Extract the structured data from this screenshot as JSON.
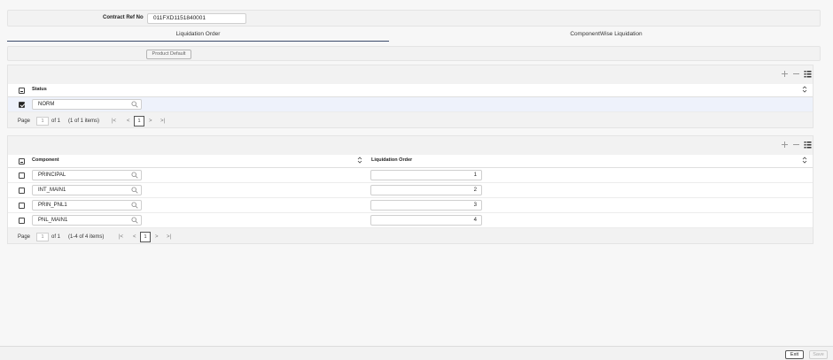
{
  "header": {
    "contract_ref_label": "Contract Ref No",
    "contract_ref_value": "011FXD1151840001"
  },
  "tabs": [
    {
      "label": "Liquidation Order",
      "active": true
    },
    {
      "label": "ComponentWise Liquidation",
      "active": false
    }
  ],
  "product_default_label": "Product Default",
  "status_grid": {
    "column": "Status",
    "rows": [
      {
        "value": "NORM",
        "checked": true
      }
    ],
    "pager": {
      "page_label": "Page",
      "page_value": "1",
      "of_label": "of 1",
      "items_label": "(1 of 1 items)",
      "current": "1"
    }
  },
  "component_grid": {
    "columns": [
      "Component",
      "Liquidation Order"
    ],
    "rows": [
      {
        "component": "PRINCIPAL",
        "order": "1"
      },
      {
        "component": "INT_MAIN1",
        "order": "2"
      },
      {
        "component": "PRIN_PNL1",
        "order": "3"
      },
      {
        "component": "PNL_MAIN1",
        "order": "4"
      }
    ],
    "pager": {
      "page_label": "Page",
      "page_value": "1",
      "of_label": "of 1",
      "items_label": "(1-4 of 4 items)",
      "current": "1"
    }
  },
  "footer": {
    "exit_label": "Exit",
    "save_label": "Save"
  },
  "icons": {
    "add": "plus-icon",
    "remove": "minus-icon",
    "columns": "column-list-icon",
    "search": "search-icon",
    "sort": "sort-icon",
    "first": "first-page-icon",
    "prev": "prev-page-icon",
    "next": "next-page-icon",
    "last": "last-page-icon"
  },
  "colors": {
    "accent": "#3b4a6b",
    "background": "#f7f7f7",
    "panel": "#f2f2f2"
  }
}
